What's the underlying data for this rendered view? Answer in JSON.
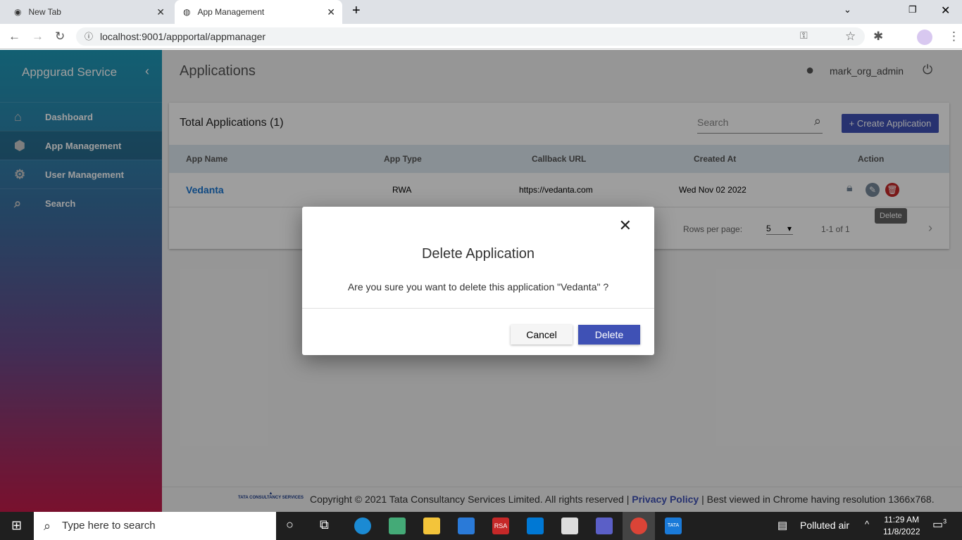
{
  "browser": {
    "tabs": [
      {
        "label": "New Tab"
      },
      {
        "label": "App Management"
      }
    ],
    "url": "localhost:9001/appportal/appmanager"
  },
  "sidebar": {
    "title": "Appgurad Service",
    "items": [
      {
        "label": "Dashboard",
        "icon": "home-icon"
      },
      {
        "label": "App Management",
        "icon": "app-settings-icon",
        "active": true
      },
      {
        "label": "User Management",
        "icon": "user-settings-icon"
      },
      {
        "label": "Search",
        "icon": "search-icon"
      }
    ]
  },
  "header": {
    "title": "Applications",
    "user": "mark_org_admin"
  },
  "card": {
    "title": "Total Applications (1)",
    "search_placeholder": "Search",
    "create_label": "+ Create Application",
    "columns": [
      "App Name",
      "App Type",
      "Callback URL",
      "Created At",
      "Action"
    ],
    "rows": [
      {
        "name": "Vedanta",
        "type": "RWA",
        "callback": "https://vedanta.com",
        "created": "Wed Nov 02 2022"
      }
    ],
    "tooltip": "Delete",
    "rows_per_page_label": "Rows per page:",
    "rows_per_page": "5",
    "range": "1-1 of 1"
  },
  "footer": {
    "copyright": "Copyright © 2021 Tata Consultancy Services Limited. All rights reserved |",
    "privacy": "Privacy Policy",
    "best": "| Best viewed in Chrome having resolution 1366x768.",
    "logo": "TATA CONSULTANCY SERVICES"
  },
  "modal": {
    "title": "Delete Application",
    "message": "Are you sure you want to delete this application \"Vedanta\" ?",
    "cancel": "Cancel",
    "delete": "Delete"
  },
  "taskbar": {
    "search": "Type here to search",
    "weather": "Polluted air",
    "time": "11:29 AM",
    "date": "11/8/2022",
    "notifications": "3"
  },
  "colors": {
    "primary": "#3f51b5",
    "link": "#1976d2",
    "delete": "#c62828"
  }
}
